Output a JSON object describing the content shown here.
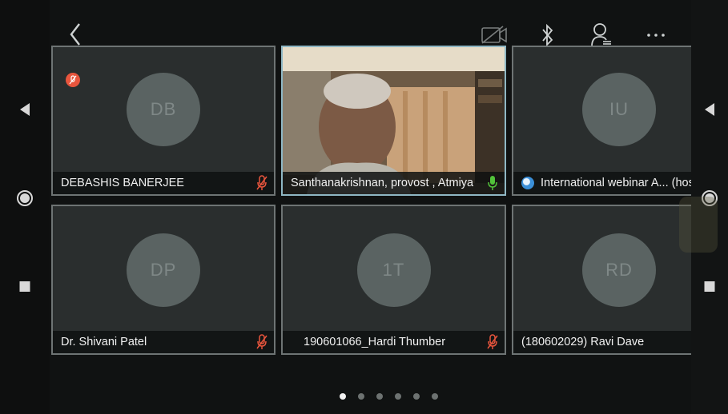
{
  "participants": [
    {
      "name": "DEBASHIS BANERJEE",
      "initials": "DB",
      "mic": "muted"
    },
    {
      "name": "Santhanakrishnan, provost , Atmiya",
      "mic": "active",
      "video": true
    },
    {
      "name": "International webinar A... (host)",
      "initials": "IU",
      "mic": "muted"
    },
    {
      "name": "Dr. Shivani Patel",
      "initials": "DP",
      "mic": "muted"
    },
    {
      "name": "190601066_Hardi Thumber",
      "initials": "1T",
      "mic": "muted"
    },
    {
      "name": "(180602029) Ravi Dave",
      "initials": "RD",
      "mic": "muted"
    }
  ],
  "pagination": {
    "pages": 6,
    "current": 1
  },
  "colors": {
    "tile_bg": "#2a2e2e",
    "tile_border": "#6e7474",
    "active_border": "#8fb7c4",
    "muted_mic": "#e8553d",
    "active_mic": "#52c23a",
    "avatar": "#5a6362"
  },
  "icons": [
    "back-icon",
    "video-off-icon",
    "bluetooth-icon",
    "participants-icon",
    "more-icon",
    "close-icon"
  ]
}
